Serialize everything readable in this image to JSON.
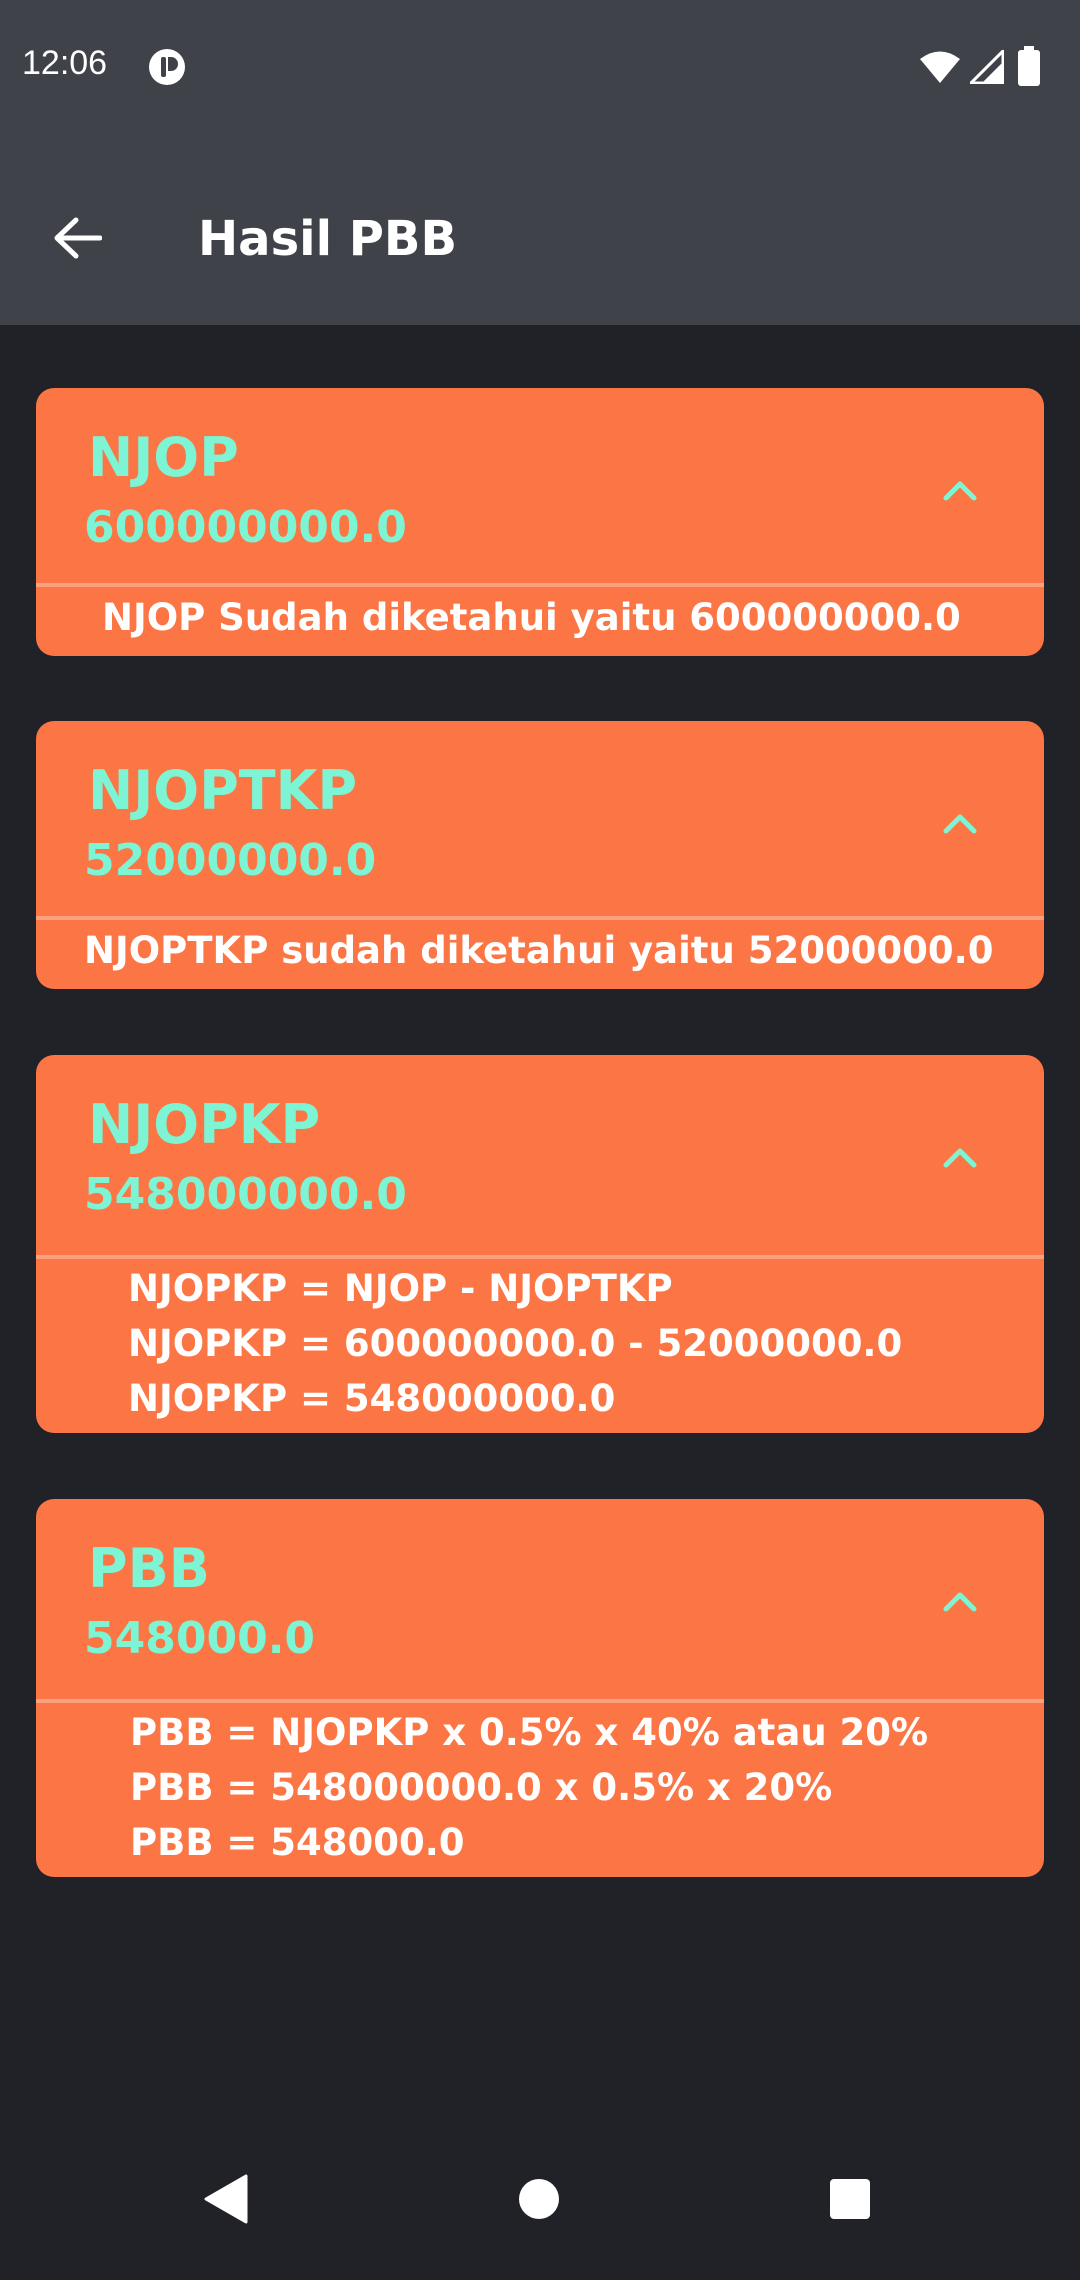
{
  "status": {
    "time": "12:06"
  },
  "toolbar": {
    "title": "Hasil PBB"
  },
  "cards": [
    {
      "title": "NJOP",
      "value": "600000000.0",
      "lines": [
        "NJOP Sudah diketahui yaitu 600000000.0"
      ]
    },
    {
      "title": "NJOPTKP",
      "value": "52000000.0",
      "lines": [
        "NJOPTKP sudah diketahui yaitu 52000000.0"
      ]
    },
    {
      "title": "NJOPKP",
      "value": "548000000.0",
      "lines": [
        "NJOPKP = NJOP - NJOPTKP",
        "NJOPKP = 600000000.0 - 52000000.0",
        "NJOPKP = 548000000.0"
      ]
    },
    {
      "title": "PBB",
      "value": "548000.0",
      "lines": [
        "PBB = NJOPKP x 0.5% x 40% atau 20%",
        "PBB = 548000000.0 x 0.5% x 20%",
        "PBB = 548000.0"
      ]
    }
  ],
  "icons": {
    "app": "app-notification-icon",
    "wifi": "wifi-icon",
    "signal": "signal-icon",
    "battery": "battery-icon",
    "back": "arrow-back-icon",
    "chevron": "chevron-up-icon",
    "nav_back": "nav-back-icon",
    "nav_home": "nav-home-icon",
    "nav_recents": "nav-recents-icon"
  },
  "colors": {
    "card": "#fb7545",
    "accent": "#7df5d5",
    "appbar": "#3f4249",
    "background": "#202227"
  }
}
